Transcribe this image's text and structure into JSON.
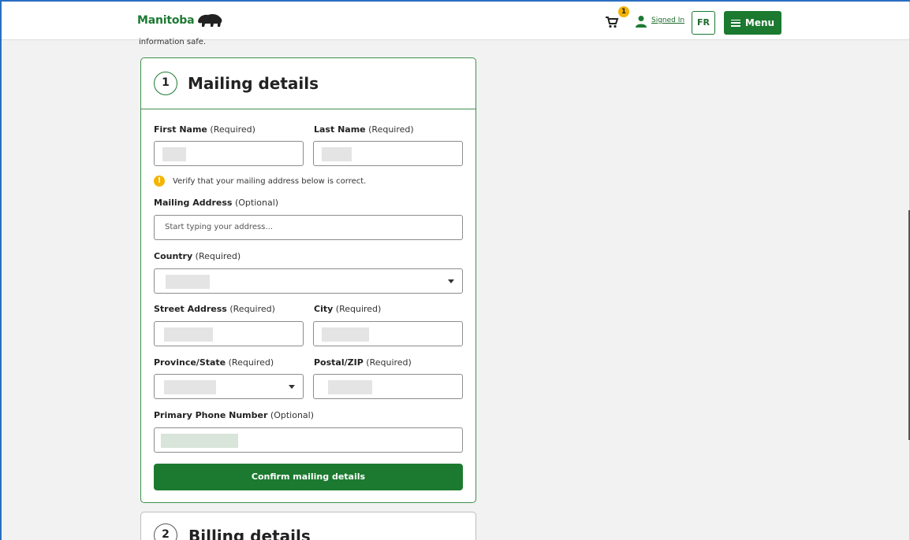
{
  "header": {
    "logo_text": "Manitoba",
    "cart_count": "1",
    "signed_in_label": "Signed In",
    "language_button": "FR",
    "menu_button": "Menu"
  },
  "intro_text": "information safe.",
  "mailing": {
    "step": "1",
    "title": "Mailing details",
    "first_name": {
      "label": "First Name",
      "req": "(Required)"
    },
    "last_name": {
      "label": "Last Name",
      "req": "(Required)"
    },
    "verify_notice": "Verify that your mailing address below is correct.",
    "mailing_address": {
      "label": "Mailing Address",
      "req": "(Optional)",
      "placeholder": "Start typing your address..."
    },
    "country": {
      "label": "Country",
      "req": "(Required)"
    },
    "street": {
      "label": "Street Address",
      "req": "(Required)"
    },
    "city": {
      "label": "City",
      "req": "(Required)"
    },
    "province": {
      "label": "Province/State",
      "req": "(Required)"
    },
    "postal": {
      "label": "Postal/ZIP",
      "req": "(Required)"
    },
    "phone": {
      "label": "Primary Phone Number",
      "req": "(Optional)"
    },
    "confirm_button": "Confirm mailing details"
  },
  "billing": {
    "step": "2",
    "title": "Billing details"
  },
  "colors": {
    "brand_green": "#1b7a2f",
    "warning_yellow": "#f4b400"
  }
}
